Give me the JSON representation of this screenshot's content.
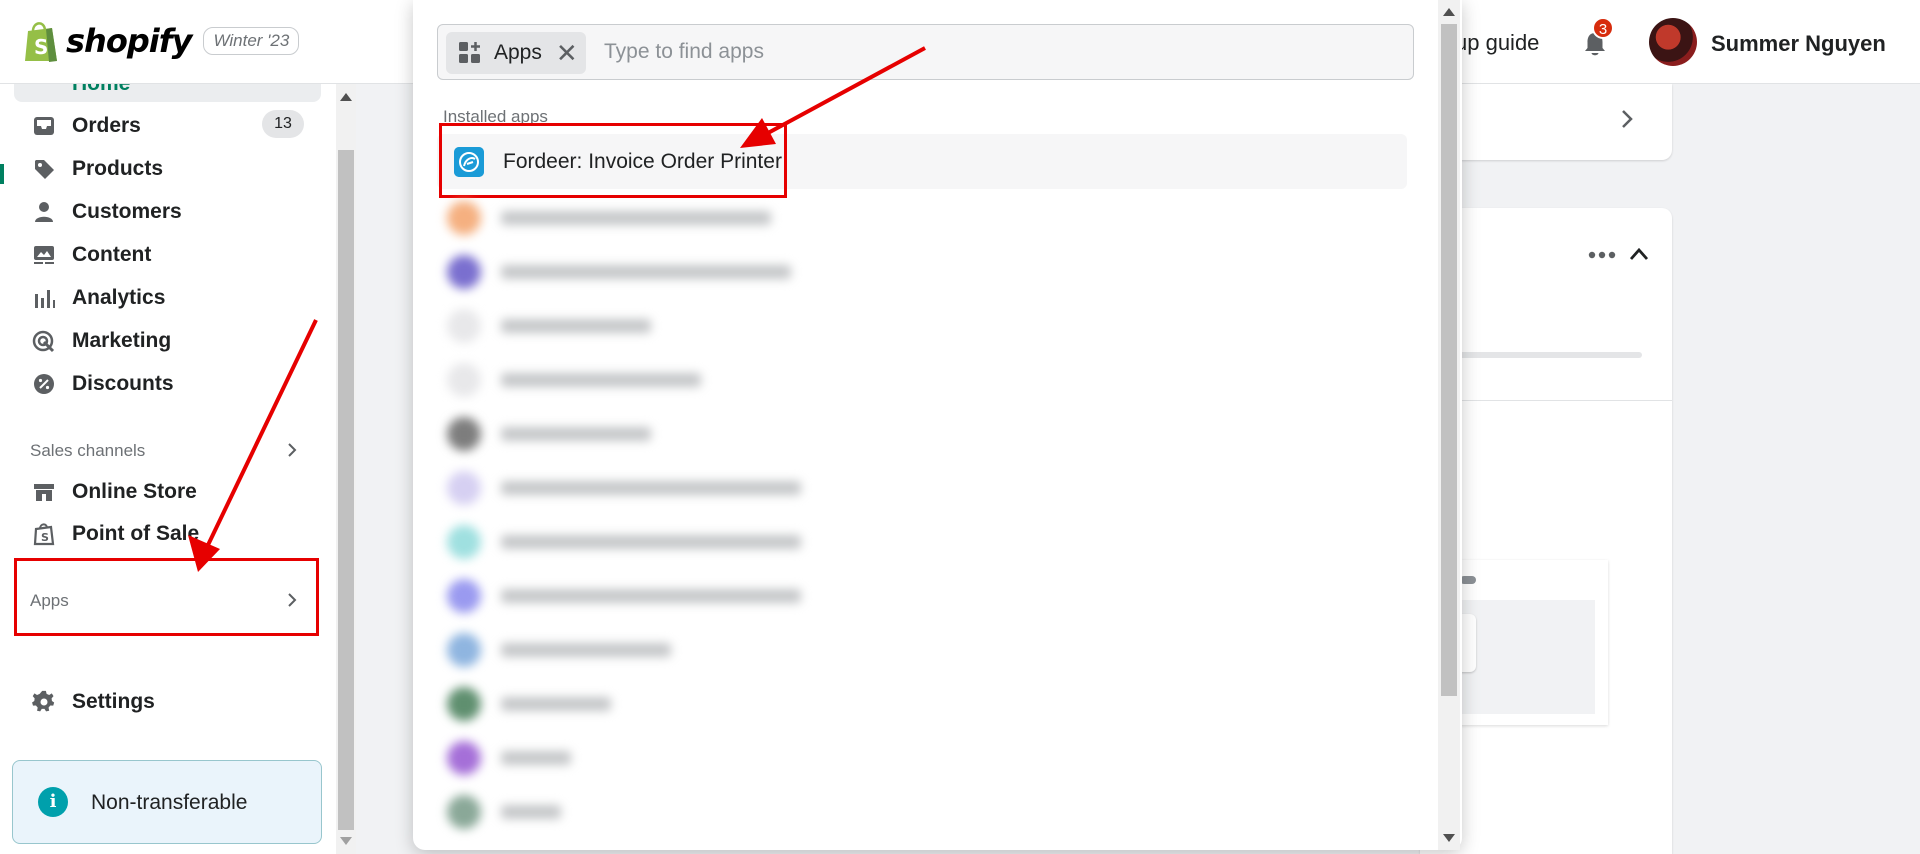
{
  "topbar": {
    "logo_text": "shopify",
    "edition": "Winter '23",
    "setup_guide": "up guide",
    "notification_count": "3",
    "user_name": "Summer Nguyen"
  },
  "sidebar": {
    "home": "Home",
    "orders": "Orders",
    "orders_count": "13",
    "products": "Products",
    "customers": "Customers",
    "content": "Content",
    "analytics": "Analytics",
    "marketing": "Marketing",
    "discounts": "Discounts",
    "sales_channels": "Sales channels",
    "online_store": "Online Store",
    "point_of_sale": "Point of Sale",
    "apps": "Apps",
    "settings": "Settings",
    "notice": "Non-transferable"
  },
  "popover": {
    "chip_label": "Apps",
    "search_placeholder": "Type to find apps",
    "section_label": "Installed apps",
    "highlighted_app": "Fordeer: Invoice Order Printer"
  },
  "colors": {
    "brand_green": "#008060",
    "highlight_red": "#e60000",
    "badge_red": "#d72c0d",
    "app_icon_blue": "#1a9bd7"
  }
}
